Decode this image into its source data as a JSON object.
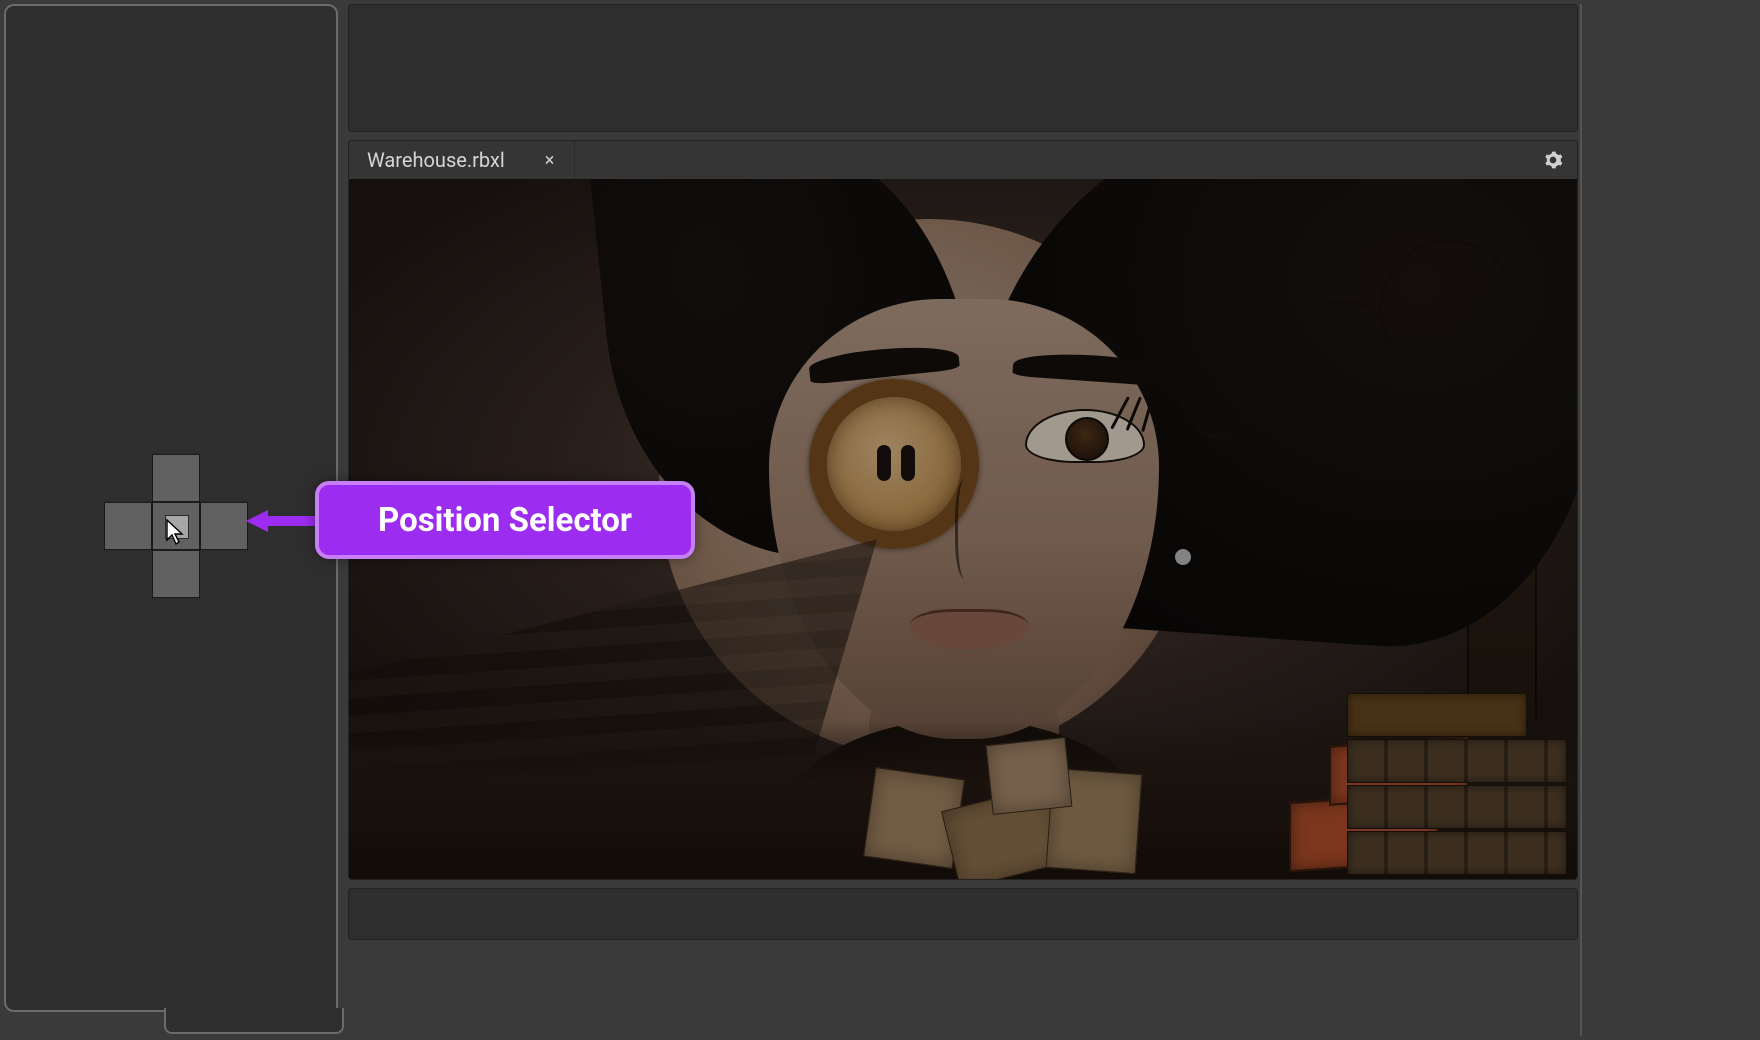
{
  "document": {
    "tab_name": "Warehouse.rbxl"
  },
  "callout": {
    "label": "Position Selector"
  },
  "icons": {
    "close": "×",
    "gear": "gear"
  }
}
